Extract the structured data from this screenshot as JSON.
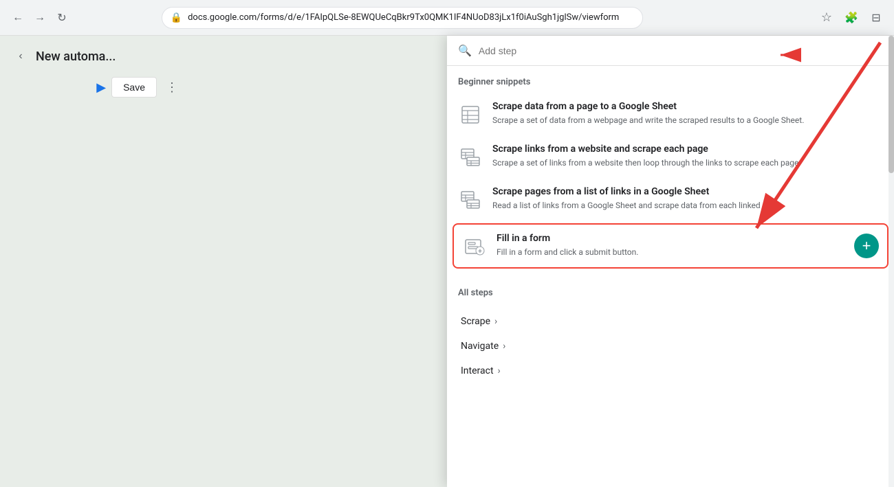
{
  "browser": {
    "url": "docs.google.com/forms/d/e/1FAIpQLSe-8EWQUeCqBkr9Tx0QMK1IF4NUoD83jLx1f0iAuSgh1jglSw/viewform",
    "back_disabled": false,
    "forward_disabled": false
  },
  "header": {
    "back_label": "‹",
    "title": "New automa...",
    "save_label": "Save",
    "play_icon": "▶",
    "more_icon": "⋮"
  },
  "panel": {
    "search_placeholder": "Add step",
    "beginner_label": "Beginner snippets",
    "snippets": [
      {
        "id": "scrape-to-sheet",
        "title": "Scrape data from a page to a Google Sheet",
        "desc": "Scrape a set of data from a webpage and write the scraped results to a Google Sheet.",
        "highlighted": false
      },
      {
        "id": "scrape-links",
        "title": "Scrape links from a website and scrape each page",
        "desc": "Scrape a set of links from a website then loop through the links to scrape each page.",
        "highlighted": false
      },
      {
        "id": "scrape-from-sheet",
        "title": "Scrape pages from a list of links in a Google Sheet",
        "desc": "Read a list of links from a Google Sheet and scrape data from each linked page.",
        "highlighted": false
      },
      {
        "id": "fill-form",
        "title": "Fill in a form",
        "desc": "Fill in a form and click a submit button.",
        "highlighted": true
      }
    ],
    "all_steps_label": "All steps",
    "all_steps": [
      {
        "id": "scrape",
        "label": "Scrape"
      },
      {
        "id": "navigate",
        "label": "Navigate"
      },
      {
        "id": "interact",
        "label": "Interact"
      }
    ],
    "add_btn_label": "+"
  },
  "icons": {
    "search": "🔍",
    "star": "☆",
    "extensions": "🧩",
    "media": "⊟",
    "lock": "🔒",
    "chevron_right": "›",
    "chevron_left": "‹"
  }
}
